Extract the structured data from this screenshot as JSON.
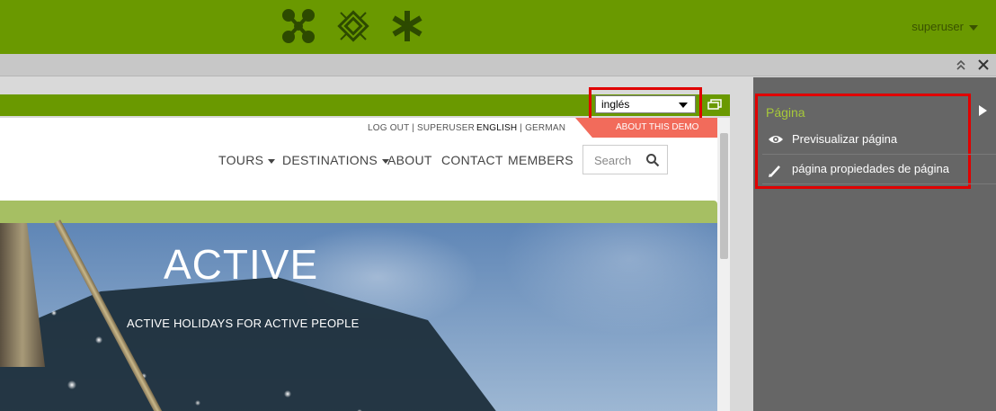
{
  "toolbar": {
    "icons": [
      "network-icon",
      "diamond-icon",
      "asterisk-icon"
    ],
    "user": "superuser",
    "accent": "#6a9900"
  },
  "subbar": {
    "controls": [
      "collapse-icon",
      "close-icon"
    ]
  },
  "language_select": {
    "value": "inglés"
  },
  "site": {
    "top_links": {
      "logout": "LOG OUT | SUPERUSER",
      "lang_active": "ENGLISH",
      "lang_sep": " | ",
      "lang_other": "GERMAN"
    },
    "demo_tab": "ABOUT THIS DEMO",
    "nav": [
      "TOURS",
      "DESTINATIONS",
      "ABOUT",
      "CONTACT",
      "MEMBERS"
    ],
    "search_placeholder": "Search",
    "hero_title": "ACTIVE",
    "hero_subtitle": "ACTIVE HOLIDAYS FOR ACTIVE PEOPLE"
  },
  "panel": {
    "title": "Página",
    "items": [
      "Previsualizar página",
      "página propiedades de página"
    ]
  }
}
